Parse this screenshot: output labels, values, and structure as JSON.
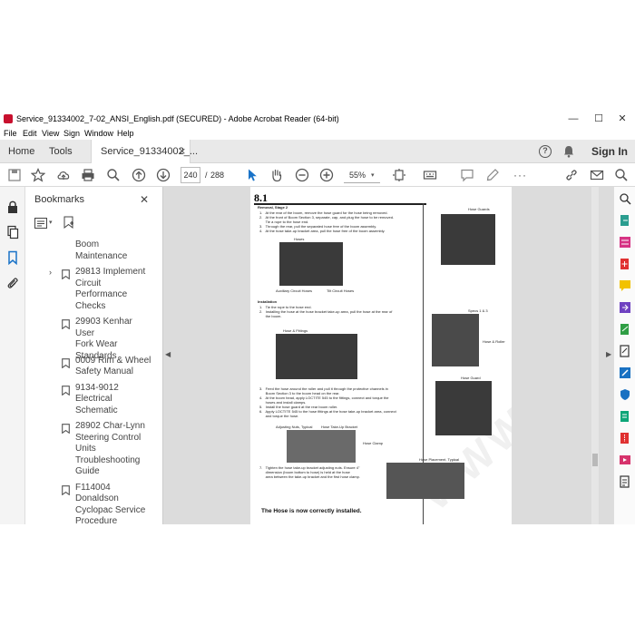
{
  "window": {
    "title": "Service_91334002_7-02_ANSI_English.pdf (SECURED) - Adobe Acrobat Reader (64-bit)",
    "controls": {
      "minimize": "—",
      "maximize": "☐",
      "close": "✕"
    }
  },
  "menu": [
    "File",
    "Edit",
    "View",
    "Sign",
    "Window",
    "Help"
  ],
  "tabs": {
    "home": "Home",
    "tools": "Tools",
    "document": "Service_91334002_...",
    "close": "×",
    "sign_in": "Sign In"
  },
  "toolbar": {
    "page_current": "240",
    "page_sep": "/",
    "page_total": "288",
    "zoom": "55%"
  },
  "bookmarks": {
    "title": "Bookmarks",
    "close": "✕",
    "items": [
      {
        "lines": [
          "Boom",
          "Maintenance"
        ],
        "has_icon": false,
        "expand": false
      },
      {
        "lines": [
          "29813 Implement",
          "Circuit",
          "Performance",
          "Checks"
        ],
        "has_icon": true,
        "expand": true
      },
      {
        "lines": [
          "29903 Kenhar User",
          "Fork Wear",
          "Standards"
        ],
        "has_icon": true,
        "expand": false
      },
      {
        "lines": [
          "0009 Rim & Wheel",
          "Safety Manual"
        ],
        "has_icon": true,
        "expand": false
      },
      {
        "lines": [
          "9134-9012",
          "Electrical",
          "Schematic"
        ],
        "has_icon": true,
        "expand": false
      },
      {
        "lines": [
          "28902 Char-Lynn",
          "Steering Control",
          "Units",
          "Troubleshooting",
          "Guide"
        ],
        "has_icon": true,
        "expand": false
      },
      {
        "lines": [
          "F114004",
          "Donaldson",
          "Cyclopac Service",
          "Procedure"
        ],
        "has_icon": true,
        "expand": false
      }
    ]
  },
  "page_content": {
    "section": "8.1",
    "removal_heading": "Removal, Stage 2",
    "removal_steps": [
      "1.   At the rear of the boom, remove the hose guard for the hose being removed.",
      "2.   At the front of Boom Section 3, separate, cap, and plug the hose to be removed.",
      "      Tie a rope to the hose end.",
      "3.   Through the rear, pull the separated hose free of the boom assembly.",
      "4.   At the hose take-up bracket area, pull the hose free of the boom assembly."
    ],
    "label_hoses": "Hoses",
    "label_aux": "Auxiliary Circuit Hoses",
    "label_tilt": "Tilt Circuit Hoses",
    "install_heading": "Installation",
    "install_steps": [
      "1.   Tie the rope to the hose end.",
      "2.   Installing the hose at the hose bracket take-up area, pull the hose at the rear of",
      "      the boom."
    ],
    "label_hose_fittings": "Hose & Fittings",
    "install_steps_2": [
      "3.   Feed the hose around the roller and pull it through the protective channels in",
      "      Boom Section 3 to the boom head on the rear.",
      "4.   At the boom head, apply LOCTITE 545 to the fittings, connect and torque the",
      "      hoses and install clamps.",
      "5.   Install the hose guard at the rear boom roller.",
      "6.   Apply LOCTITE 545 to the hose fittings at the hose take-up bracket area, connect",
      "      and torque the hose."
    ],
    "label_adjusting": "Adjusting Nuts, Typical",
    "label_takeup": "Hose Take-Up Bracket",
    "label_clamp": "Hose Clamp",
    "step7": [
      "7.   Tighten the hose take-up bracket adjusting nuts. Ensure 4\"",
      "      dimension (boom bottom to hose) is held at the hose",
      "      area between the take-up bracket and the first hose clamp."
    ],
    "label_routing": "Hose Placement, Typical",
    "label_hose_guards": "Hose Guards",
    "label_specs": "Specs 1 & 3",
    "label_hose_roller": "Hose & Roller",
    "label_hose_guard": "Hose Guard",
    "footer": "The Hose is now correctly installed.",
    "watermark": "WWW.EPCEPO.COM"
  }
}
